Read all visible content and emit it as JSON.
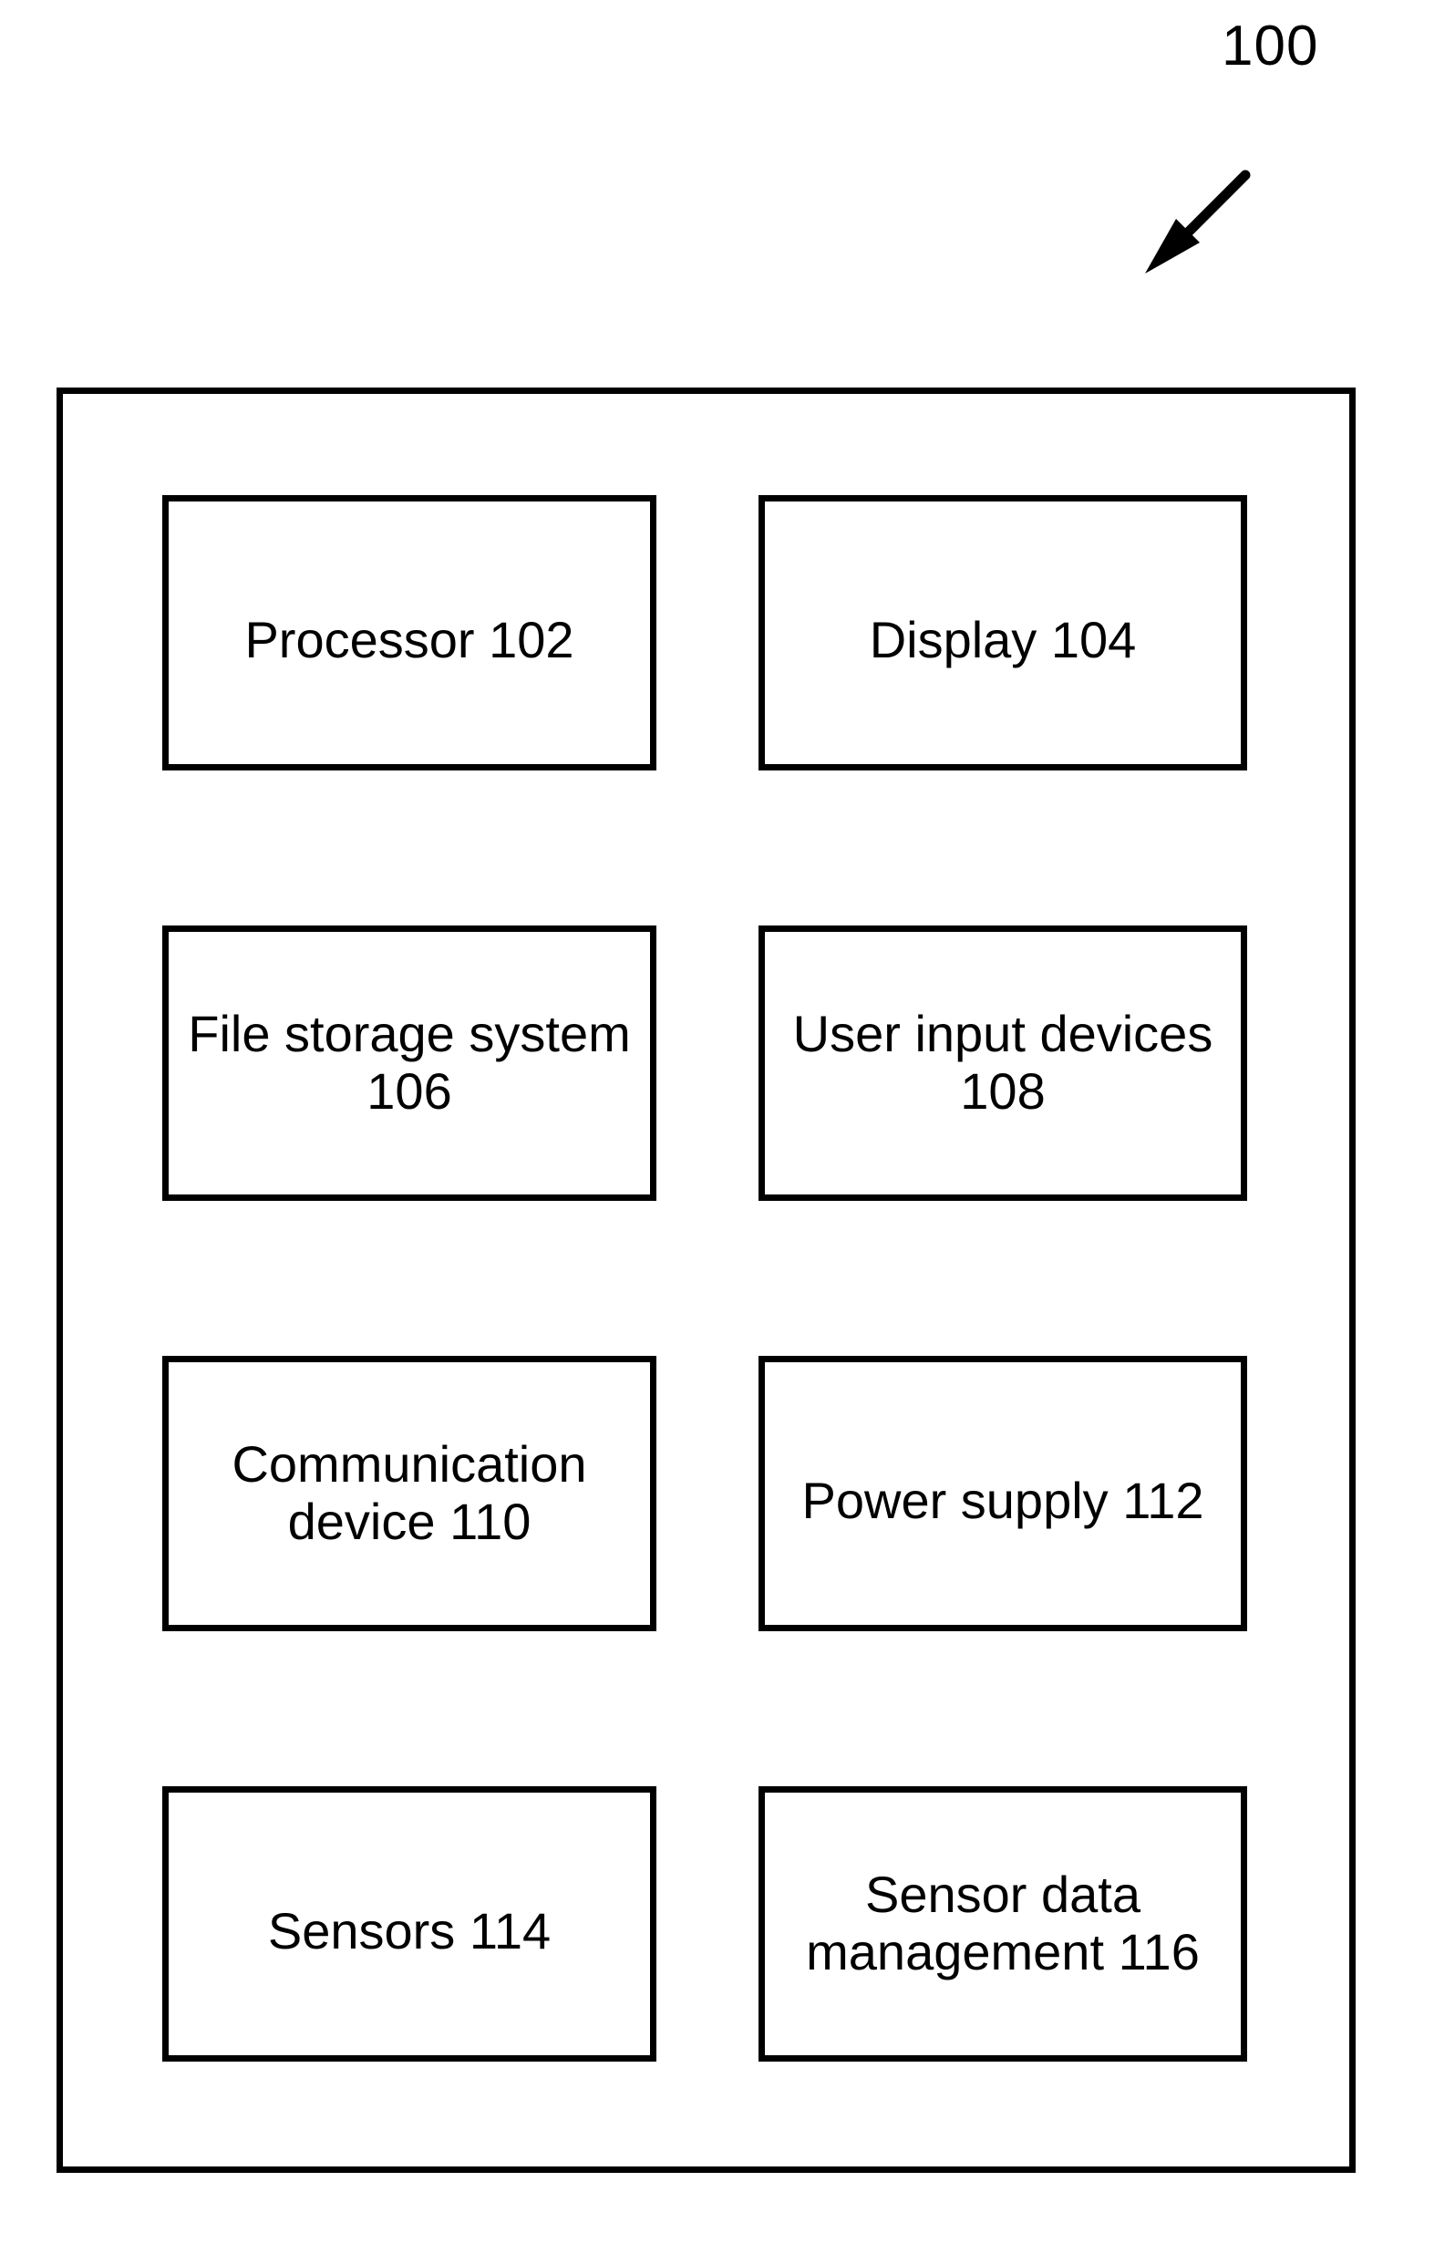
{
  "figure": {
    "reference_numeral": "100",
    "arrow_icon": "lead-line-arrow-icon",
    "stroke_color": "#000000",
    "background_color": "#ffffff"
  },
  "system": {
    "components": [
      {
        "label": "Processor 102",
        "numeral": "102",
        "name": "processor",
        "lines": 1
      },
      {
        "label": "Display 104",
        "numeral": "104",
        "name": "display",
        "lines": 1
      },
      {
        "label": "File storage system 106",
        "numeral": "106",
        "name": "file-storage-system",
        "lines": 2
      },
      {
        "label": "User input devices 108",
        "numeral": "108",
        "name": "user-input-devices",
        "lines": 2
      },
      {
        "label": "Communication device 110",
        "numeral": "110",
        "name": "communication-device",
        "lines": 2
      },
      {
        "label": "Power supply 112",
        "numeral": "112",
        "name": "power-supply",
        "lines": 1
      },
      {
        "label": "Sensors 114",
        "numeral": "114",
        "name": "sensors",
        "lines": 1
      },
      {
        "label": "Sensor data management 116",
        "numeral": "116",
        "name": "sensor-data-management",
        "lines": 2
      }
    ]
  }
}
